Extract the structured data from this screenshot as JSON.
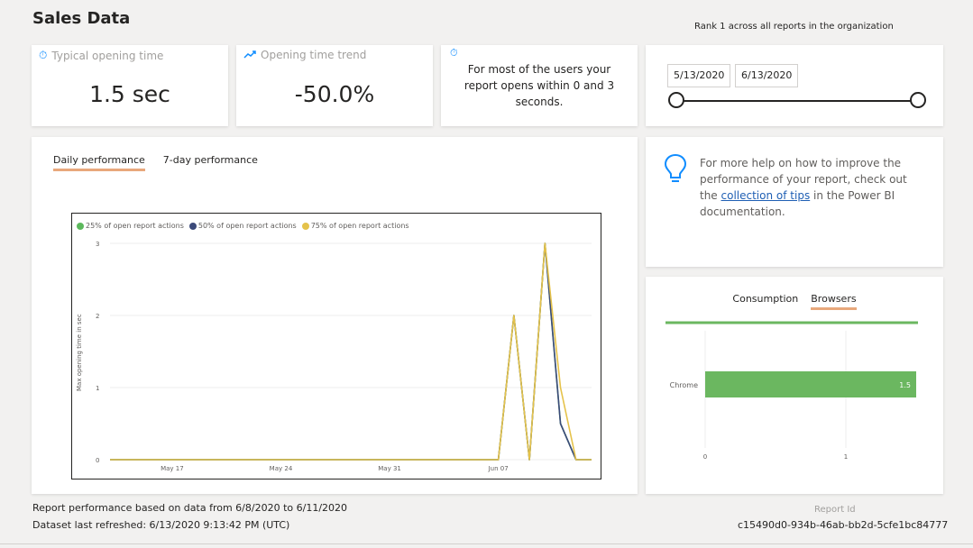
{
  "header": {
    "title": "Sales Data",
    "rank_text": "Rank 1 across all reports in the organization"
  },
  "kpis": [
    {
      "label": "Typical opening time",
      "value": "1.5 sec",
      "icon": "stopwatch-icon"
    },
    {
      "label": "Opening time trend",
      "value": "-50.0%",
      "icon": "trend-up-icon"
    },
    {
      "description": "For most of the users your report opens within 0 and 3 seconds.",
      "icon": "stopwatch-icon"
    }
  ],
  "date_range": {
    "start": "5/13/2020",
    "end": "6/13/2020"
  },
  "performance": {
    "tabs": [
      {
        "label": "Daily performance",
        "active": true
      },
      {
        "label": "7-day performance",
        "active": false
      }
    ],
    "legend": [
      {
        "label": "25% of open report actions",
        "color": "#5cb85c"
      },
      {
        "label": "50% of open report actions",
        "color": "#3b4a7a"
      },
      {
        "label": "75% of open report actions",
        "color": "#e5c24a"
      }
    ]
  },
  "chart_data": [
    {
      "type": "line",
      "ylabel": "Max opening time in sec",
      "ylim": [
        0,
        3
      ],
      "yticks": [
        0,
        1,
        2,
        3
      ],
      "xticks": [
        "May 17",
        "May 24",
        "May 31",
        "Jun 07"
      ],
      "x": [
        "May 13",
        "May 14",
        "May 15",
        "May 16",
        "May 17",
        "May 18",
        "May 19",
        "May 20",
        "May 21",
        "May 22",
        "May 23",
        "May 24",
        "May 25",
        "May 26",
        "May 27",
        "May 28",
        "May 29",
        "May 30",
        "May 31",
        "Jun 01",
        "Jun 02",
        "Jun 03",
        "Jun 04",
        "Jun 05",
        "Jun 06",
        "Jun 07",
        "Jun 08",
        "Jun 09",
        "Jun 10",
        "Jun 11",
        "Jun 12",
        "Jun 13"
      ],
      "series": [
        {
          "name": "25% of open report actions",
          "color": "#5cb85c",
          "values": [
            0,
            0,
            0,
            0,
            0,
            0,
            0,
            0,
            0,
            0,
            0,
            0,
            0,
            0,
            0,
            0,
            0,
            0,
            0,
            0,
            0,
            0,
            0,
            0,
            0,
            0,
            2,
            0,
            3,
            0.5,
            0,
            0
          ]
        },
        {
          "name": "50% of open report actions",
          "color": "#3b4a7a",
          "values": [
            0,
            0,
            0,
            0,
            0,
            0,
            0,
            0,
            0,
            0,
            0,
            0,
            0,
            0,
            0,
            0,
            0,
            0,
            0,
            0,
            0,
            0,
            0,
            0,
            0,
            0,
            2,
            0,
            3,
            0.5,
            0,
            0
          ]
        },
        {
          "name": "75% of open report actions",
          "color": "#e5c24a",
          "values": [
            0,
            0,
            0,
            0,
            0,
            0,
            0,
            0,
            0,
            0,
            0,
            0,
            0,
            0,
            0,
            0,
            0,
            0,
            0,
            0,
            0,
            0,
            0,
            0,
            0,
            0,
            2,
            0,
            3,
            1,
            0,
            0
          ]
        }
      ]
    },
    {
      "type": "bar",
      "orientation": "horizontal",
      "categories": [
        "Chrome"
      ],
      "values": [
        1.5
      ],
      "xticks": [
        0,
        1
      ],
      "xlim": [
        0,
        1.5
      ],
      "color": "#6bb760"
    }
  ],
  "tips": {
    "text_before": "For more help on how to improve the performance of your report, check out the ",
    "link_text": "collection of tips",
    "text_after": " in the Power BI documentation."
  },
  "browsers": {
    "tabs": [
      {
        "label": "Consumption",
        "active": false
      },
      {
        "label": "Browsers",
        "active": true
      }
    ]
  },
  "footer": {
    "based_on": "Report performance based on data from 6/8/2020 to 6/11/2020",
    "refreshed": "Dataset last refreshed: 6/13/2020 9:13:42 PM (UTC)",
    "report_id_label": "Report Id",
    "report_id": "c15490d0-934b-46ab-bb2d-5cfe1bc84777"
  }
}
